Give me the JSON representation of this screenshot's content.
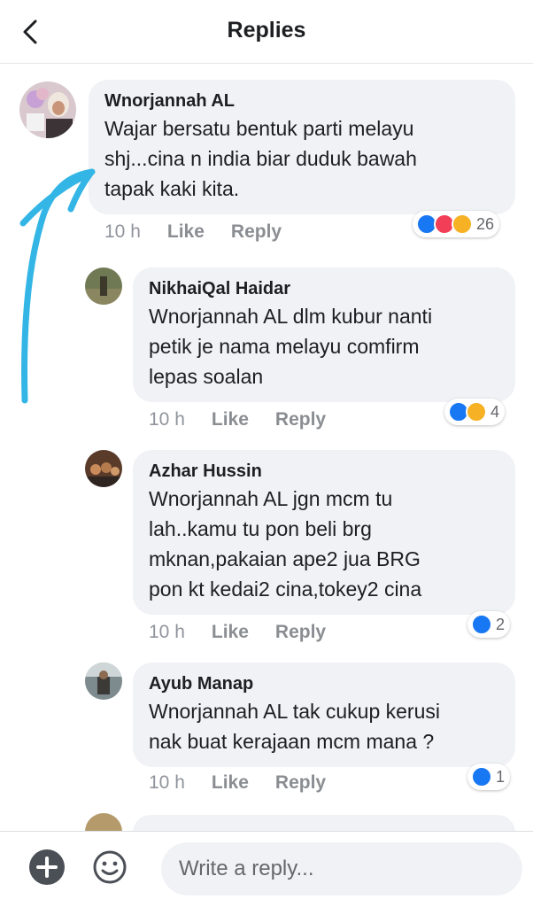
{
  "header": {
    "title": "Replies"
  },
  "comments": [
    {
      "name": "Wnorjannah AL",
      "lines": [
        "Wajar bersatu bentuk parti melayu",
        "shj...cina n india biar duduk bawah",
        "tapak kaki kita."
      ],
      "time": "10 h",
      "like": "Like",
      "reply": "Reply",
      "reaction_count": "26"
    },
    {
      "name": "NikhaiQal Haidar",
      "lines": [
        "Wnorjannah AL dlm kubur nanti",
        "petik je nama melayu comfirm",
        "lepas soalan"
      ],
      "time": "10 h",
      "like": "Like",
      "reply": "Reply",
      "reaction_count": "4"
    },
    {
      "name": "Azhar Hussin",
      "lines": [
        "Wnorjannah AL jgn mcm tu",
        "lah..kamu tu pon beli brg",
        "mknan,pakaian ape2 jua BRG",
        "pon kt kedai2 cina,tokey2 cina"
      ],
      "time": "10 h",
      "like": "Like",
      "reply": "Reply",
      "reaction_count": "2"
    },
    {
      "name": "Ayub Manap",
      "lines": [
        "Wnorjannah AL tak cukup kerusi",
        "nak buat kerajaan mcm mana ?"
      ],
      "time": "10 h",
      "like": "Like",
      "reply": "Reply",
      "reaction_count": "1"
    }
  ],
  "composer": {
    "placeholder": "Write a reply..."
  },
  "colors": {
    "bubble": "#f0f2f5",
    "like_blue": "#1877f2",
    "annotation_arrow": "#33b5e5"
  }
}
